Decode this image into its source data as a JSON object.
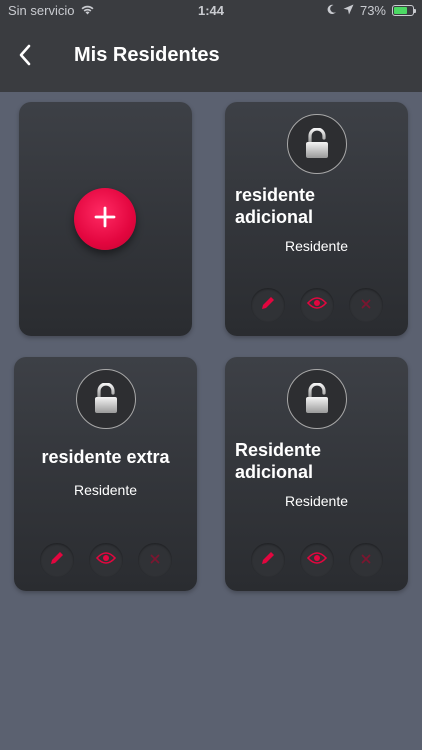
{
  "status_bar": {
    "carrier": "Sin servicio",
    "time": "1:44",
    "battery": "73%"
  },
  "header": {
    "title": "Mis Residentes"
  },
  "colors": {
    "accent": "#e3063f",
    "background": "#5b6170",
    "header": "#3a3c40",
    "card": "#2f3135"
  },
  "add_card": {
    "icon": "plus-icon"
  },
  "residents": [
    {
      "name_line1": "residente",
      "name_line2": "adicional",
      "role": "Residente"
    },
    {
      "name": "residente extra",
      "role": "Residente"
    },
    {
      "name_line1": "Residente",
      "name_line2": "adicional",
      "role": "Residente"
    }
  ],
  "card_actions": [
    "edit-icon",
    "view-icon",
    "delete-icon"
  ]
}
